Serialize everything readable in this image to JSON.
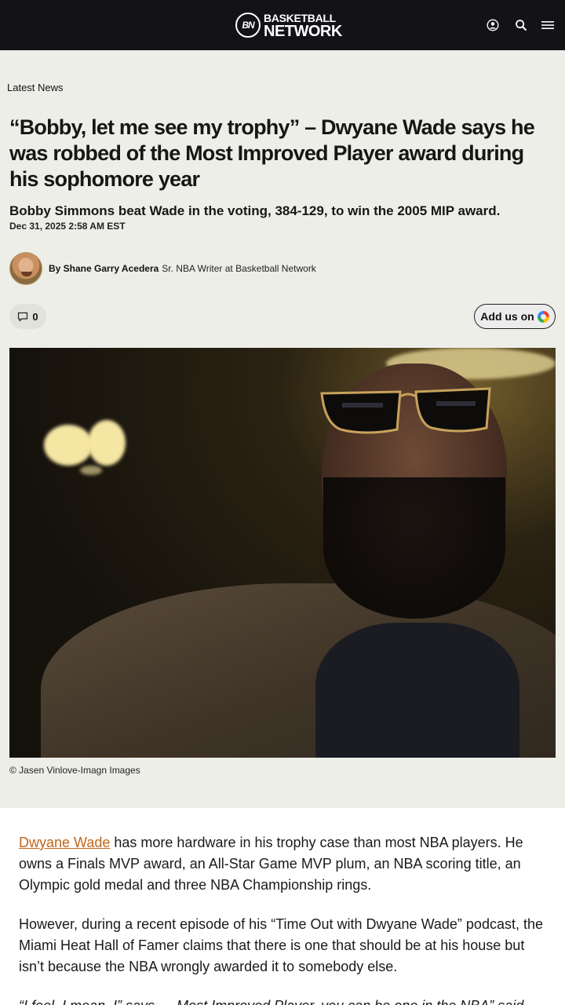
{
  "header": {
    "logo_badge": "BN",
    "logo_line1": "BASKETBALL",
    "logo_line2": "NETWORK",
    "icons": [
      "user-icon",
      "search-icon",
      "menu-icon"
    ],
    "background": "#121217"
  },
  "article": {
    "section": "Latest News",
    "title": "“Bobby, let me see my trophy” – Dwyane Wade says he was robbed of the Most Improved Player award during his sophomore year",
    "subtitle": "Bobby Simmons beat Wade in the voting, 384-129, to win the 2005 MIP award.",
    "date": "Dec 31, 2025 2:58 AM EST",
    "author": {
      "by_label": "By Shane Garry Acedera",
      "role": "Sr. NBA Writer at Basketball Network"
    },
    "comments_count": "0",
    "add_us_label": "Add us on",
    "image_caption": "© Jasen Vinlove-Imagn Images",
    "body": {
      "p1_link": "Dwyane Wade",
      "p1_rest": " has more hardware in his trophy case than most NBA players. He owns a Finals MVP award, an All-Star Game MVP plum, an NBA scoring title, an Olympic gold medal and three NBA Championship rings.",
      "p2": "However, during a recent episode of his “Time Out with Dwyane Wade” podcast, the Miami Heat Hall of Famer claims that there is one that should be at his house but isn’t because the NBA wrongly awarded it to somebody else.",
      "p3": "“I feel, I mean, I” says … Most Improved Player, you can be one in the NBA” said …"
    }
  },
  "colors": {
    "link": "#c0661a",
    "page_bg": "#eeeee9"
  }
}
